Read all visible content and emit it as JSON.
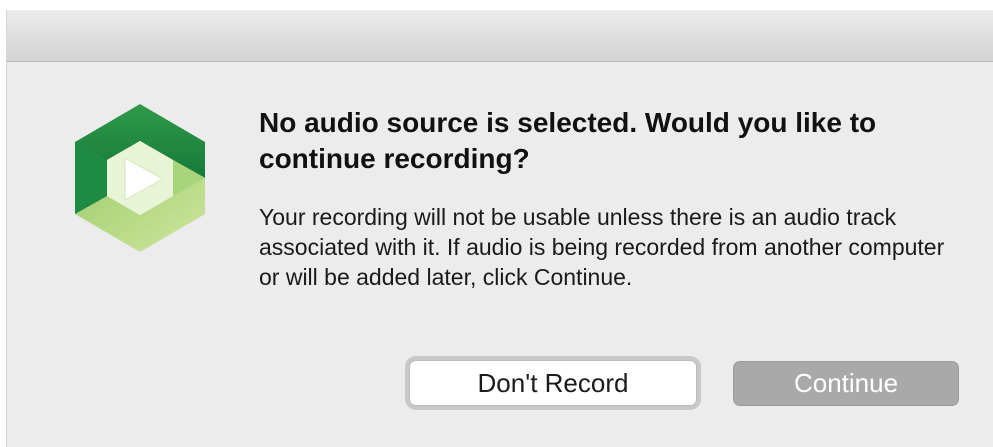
{
  "dialog": {
    "heading": "No audio source is selected. Would you like to continue recording?",
    "message": "Your recording will not be usable unless there is an audio track associated with it. If audio is being recorded from another computer or will be added later, click Continue.",
    "icon": "panopto-play-hexagon-icon",
    "colors": {
      "icon_dark_green": "#0f7a3c",
      "icon_light_green": "#b6d77a",
      "primary_button_bg": "#a9a9a9"
    }
  },
  "buttons": {
    "dont_record_label": "Don't Record",
    "continue_label": "Continue"
  }
}
